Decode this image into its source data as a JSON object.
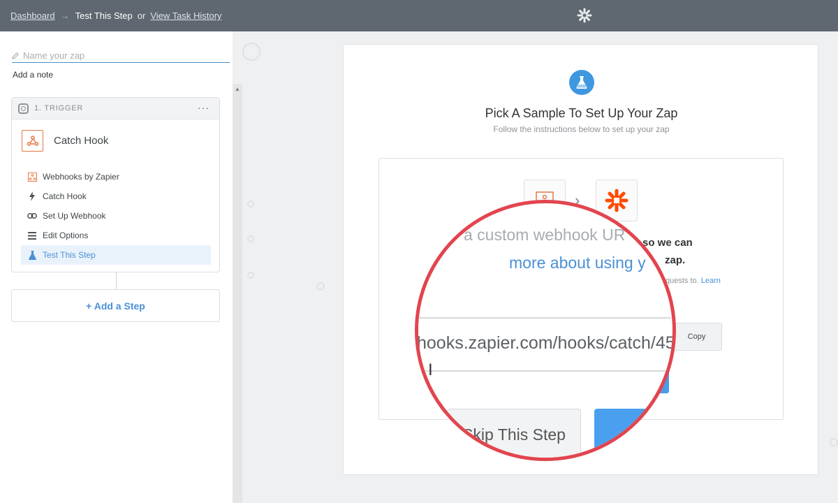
{
  "topbar": {
    "dashboard": "Dashboard",
    "arrow": "→",
    "current": "Test This Step",
    "or": "or",
    "history": "View Task History"
  },
  "sidebar": {
    "zap_name_placeholder": "Name your zap",
    "add_note": "Add a note",
    "trigger": {
      "header": "1. TRIGGER",
      "menu": "···",
      "app_title": "Catch Hook",
      "steps": [
        {
          "label": "Webhooks by Zapier",
          "icon": "webhook-icon"
        },
        {
          "label": "Catch Hook",
          "icon": "lightning-icon"
        },
        {
          "label": "Set Up Webhook",
          "icon": "link-icon"
        },
        {
          "label": "Edit Options",
          "icon": "list-icon"
        },
        {
          "label": "Test This Step",
          "icon": "flask-icon",
          "active": true
        }
      ]
    },
    "add_step": "+ Add a Step"
  },
  "main": {
    "title": "Pick A Sample To Set Up Your Zap",
    "subtitle": "Follow the instructions below to set up your zap",
    "desc_right_1": "so we can",
    "desc_right_2": "zap.",
    "small_right": "quests to.",
    "learn": "Learn",
    "copy": "Copy"
  },
  "magnifier": {
    "line1": "a custom webhook UR",
    "line2": "more about using y",
    "url": "hooks.zapier.com/hooks/catch/45",
    "skip": "Skip This Step"
  },
  "colors": {
    "topbar": "#5f6870",
    "accent_blue": "#4a90d6",
    "zapier_orange": "#ff4a00",
    "magnifier_ring": "#e2454f"
  }
}
